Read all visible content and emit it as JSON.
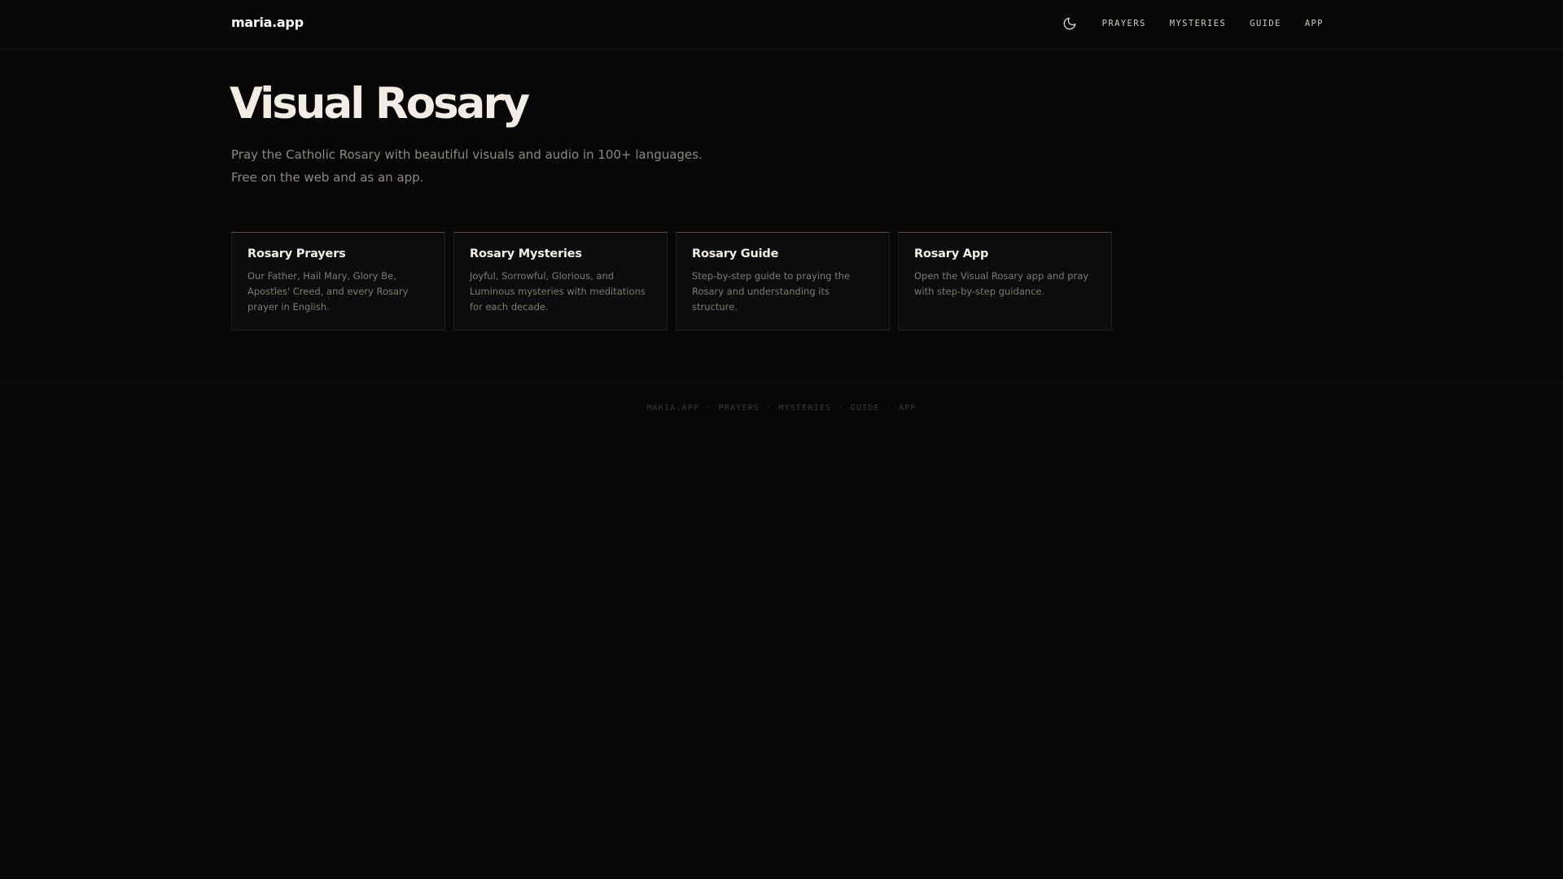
{
  "header": {
    "brand": "maria.app",
    "theme_toggle_icon": "moon-icon",
    "nav": [
      {
        "label": "PRAYERS"
      },
      {
        "label": "MYSTERIES"
      },
      {
        "label": "GUIDE"
      },
      {
        "label": "APP"
      }
    ]
  },
  "hero": {
    "title": "Visual Rosary",
    "subtitle_line1": "Pray the Catholic Rosary with beautiful visuals and audio in 100+ languages.",
    "subtitle_line2": "Free on the web and as an app."
  },
  "cards": [
    {
      "title": "Rosary Prayers",
      "description": "Our Father, Hail Mary, Glory Be, Apostles' Creed, and every Rosary prayer in English."
    },
    {
      "title": "Rosary Mysteries",
      "description": "Joyful, Sorrowful, Glorious, and Luminous mysteries with meditations for each decade."
    },
    {
      "title": "Rosary Guide",
      "description": "Step-by-step guide to praying the Rosary and understanding its structure."
    },
    {
      "title": "Rosary App",
      "description": "Open the Visual Rosary app and pray with step-by-step guidance."
    }
  ],
  "footer": {
    "separator": "·",
    "links": [
      {
        "label": "MARIA.APP"
      },
      {
        "label": "PRAYERS"
      },
      {
        "label": "MYSTERIES"
      },
      {
        "label": "GUIDE"
      },
      {
        "label": "APP"
      }
    ]
  },
  "colors": {
    "background": "#070708",
    "card_accent": "#5c4a33",
    "text_primary": "#f1ece4",
    "text_muted": "#8d8881"
  }
}
